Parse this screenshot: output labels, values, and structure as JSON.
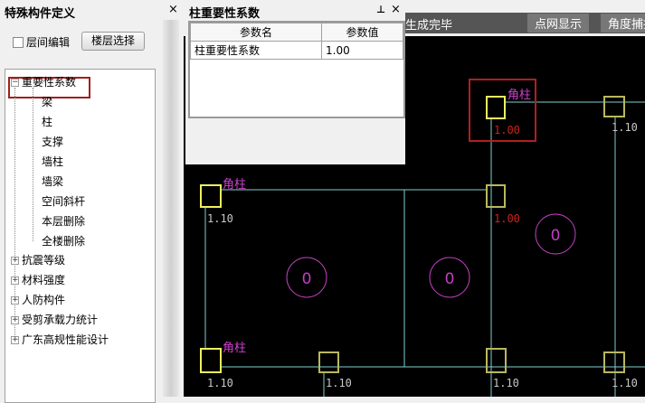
{
  "left_panel": {
    "title": "特殊构件定义",
    "floor_edit_label": "层间编辑",
    "floor_select_button": "楼层选择",
    "tree": {
      "root": "重要性系数",
      "children": [
        "梁",
        "柱",
        "支撑",
        "墙柱",
        "墙梁",
        "空间斜杆",
        "本层删除",
        "全楼删除"
      ],
      "others": [
        "抗震等级",
        "材料强度",
        "人防构件",
        "受剪承载力统计",
        "广东高规性能设计"
      ]
    }
  },
  "prop_panel": {
    "title": "柱重要性系数",
    "col_name": "参数名",
    "col_value": "参数值",
    "rows": [
      {
        "name": "柱重要性系数",
        "value": "1.00"
      }
    ]
  },
  "status": {
    "text": "生成完毕",
    "btn_grid": "点网显示",
    "btn_angle": "角度捕捉"
  },
  "canvas": {
    "corner_label": "角柱",
    "selected_value": "1.00",
    "default_value": "1.10",
    "circle_label": "0",
    "colors": {
      "background": "#000000",
      "axis": "#7fd0d0",
      "column": "#f0f060",
      "column_dim": "#b8b860",
      "label": "#d040d0",
      "value": "#c8c8c8",
      "selected": "#d02020"
    }
  },
  "icons": {
    "close": "×",
    "pin": "⊥",
    "expand": "+",
    "collapse": "−"
  }
}
